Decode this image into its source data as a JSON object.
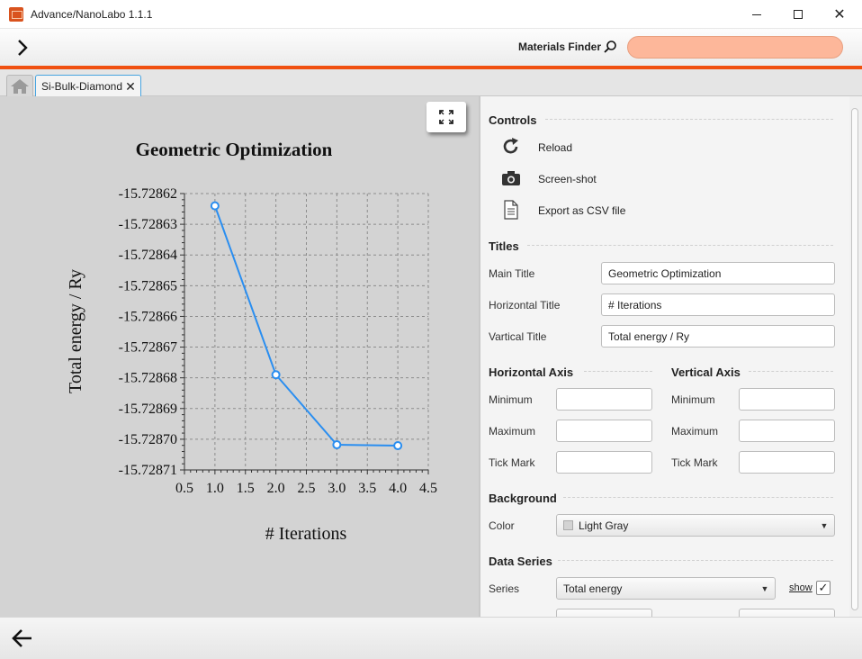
{
  "window": {
    "title": "Advance/NanoLabo 1.1.1",
    "controls": {
      "minimize": "minimize-icon",
      "maximize": "maximize-icon",
      "close": "✕"
    }
  },
  "toolbar": {
    "forward_icon": "chevron-right-icon",
    "materials_finder_label": "Materials Finder",
    "search_icon": "search-icon",
    "search_value": "",
    "accent_color": "#f05010",
    "search_bg_color": "#fdb79a"
  },
  "tabs": {
    "home_icon": "home-icon",
    "active_tab": {
      "label": "Si-Bulk-Diamond",
      "close": "✕"
    }
  },
  "chart_data": {
    "type": "line",
    "title": "Geometric Optimization",
    "xlabel": "# Iterations",
    "ylabel": "Total energy / Ry",
    "x_ticks": [
      "0.5",
      "1.0",
      "1.5",
      "2.0",
      "2.5",
      "3.0",
      "3.5",
      "4.0",
      "4.5"
    ],
    "y_ticks": [
      "-15.72862",
      "-15.72863",
      "-15.72864",
      "-15.72865",
      "-15.72866",
      "-15.72867",
      "-15.72868",
      "-15.72869",
      "-15.72870",
      "-15.72871"
    ],
    "xlim": [
      0.5,
      4.5
    ],
    "ylim": [
      -15.72871,
      -15.72862
    ],
    "grid": true,
    "background": "#d3d3d3",
    "series": [
      {
        "x": [
          1,
          2,
          3,
          4
        ],
        "y": [
          -15.728624,
          -15.728679,
          -15.7287018,
          -15.7287021
        ],
        "color": "#2a8ef0"
      }
    ]
  },
  "chart_pane": {
    "fullscreen_icon": "fullscreen-icon"
  },
  "controls": {
    "heading": "Controls",
    "items": [
      {
        "icon": "reload-icon",
        "label": "Reload"
      },
      {
        "icon": "camera-icon",
        "label": "Screen-shot"
      },
      {
        "icon": "document-icon",
        "label": "Export as CSV file"
      }
    ]
  },
  "titles": {
    "heading": "Titles",
    "main_label": "Main Title",
    "main_value": "Geometric Optimization",
    "horizontal_label": "Horizontal Title",
    "horizontal_value": "# Iterations",
    "vertical_label": "Vartical Title",
    "vertical_value": "Total energy / Ry"
  },
  "horizontal_axis": {
    "heading": "Horizontal Axis",
    "minimum_label": "Minimum",
    "minimum_value": "",
    "maximum_label": "Maximum",
    "maximum_value": "",
    "tick_label": "Tick Mark",
    "tick_value": ""
  },
  "vertical_axis": {
    "heading": "Vertical Axis",
    "minimum_label": "Minimum",
    "minimum_value": "",
    "maximum_label": "Maximum",
    "maximum_value": "",
    "tick_label": "Tick Mark",
    "tick_value": ""
  },
  "background": {
    "heading": "Background",
    "color_label": "Color",
    "color_value": "Light Gray",
    "swatch_color": "#d3d3d3"
  },
  "data_series": {
    "heading": "Data Series",
    "series_label": "Series",
    "series_value": "Total energy",
    "show_label": "show",
    "show_checked": "✓"
  },
  "bottom": {
    "back_icon": "arrow-left-icon"
  }
}
